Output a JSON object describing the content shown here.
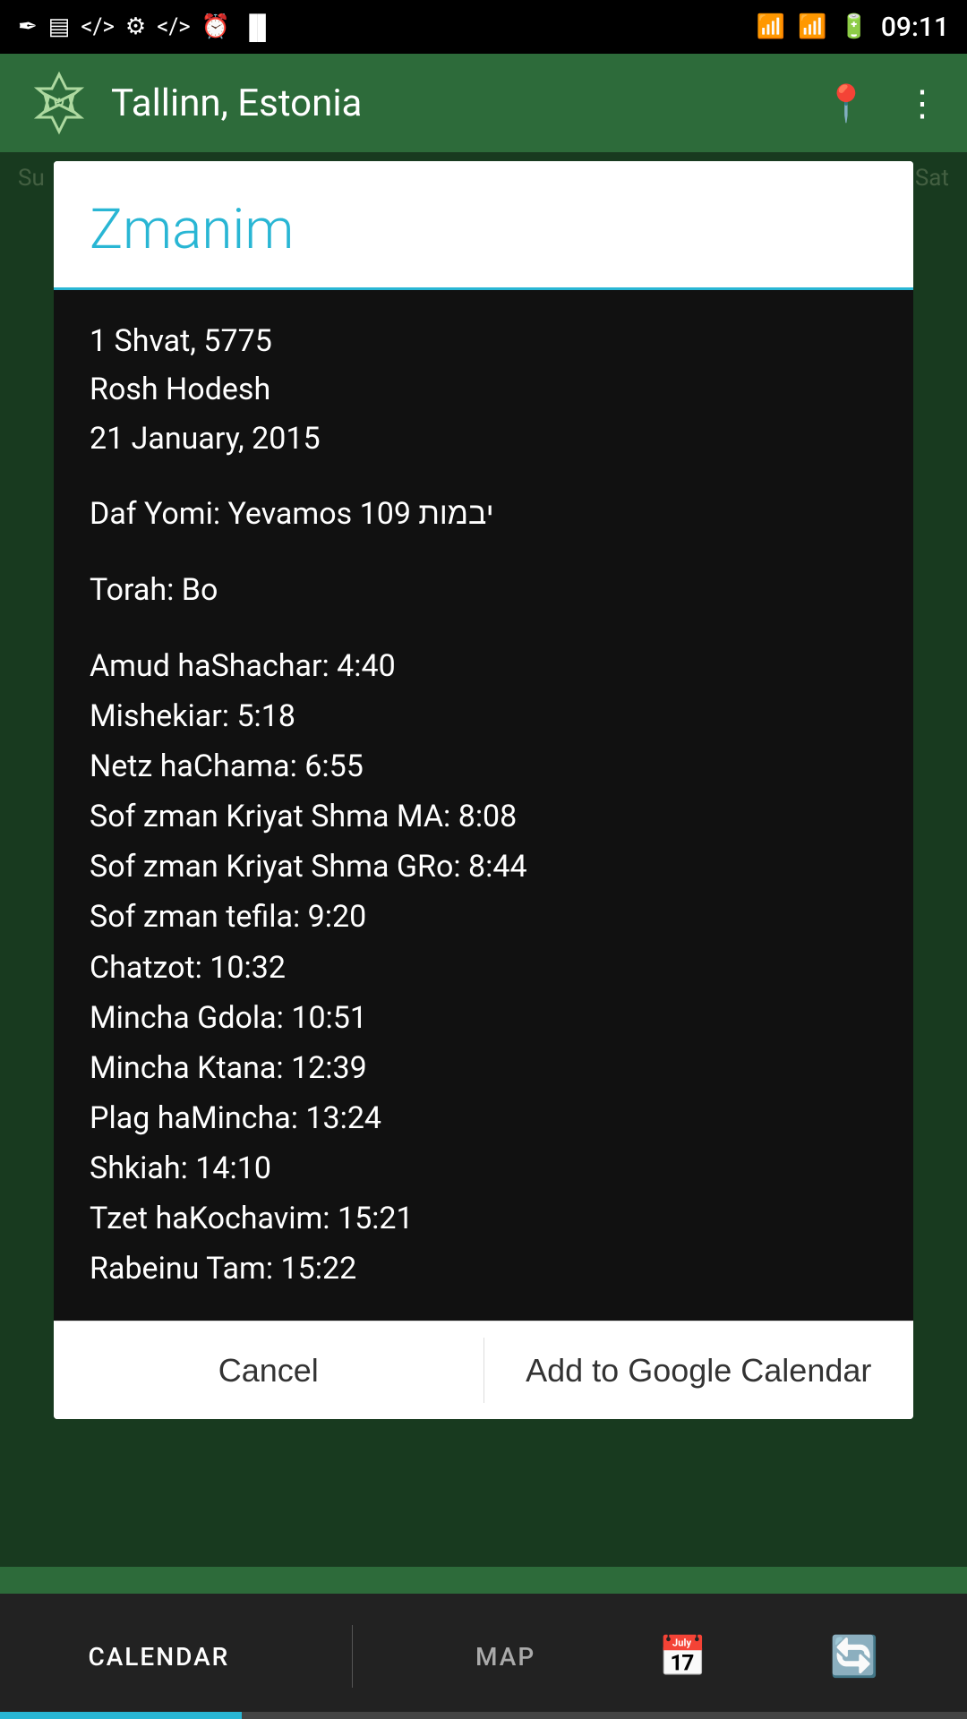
{
  "statusBar": {
    "time": "09:11",
    "leftIcons": [
      "feather-icon",
      "image-icon",
      "code-icon",
      "usb-icon",
      "code2-icon",
      "clock-icon",
      "barcode-icon"
    ],
    "rightIcons": [
      "wifi-icon",
      "signal-icon",
      "battery-icon"
    ]
  },
  "header": {
    "appTitle": "Tallinn, Estonia",
    "logoAlt": "Jewish calendar app logo"
  },
  "dialog": {
    "title": "Zmanim",
    "dateHebrew": "1 Shvat, 5775",
    "dateSpecial": "Rosh Hodesh",
    "dateGregorian": "21 January, 2015",
    "dafYomi": "Daf Yomi: Yevamos 109 יבמות",
    "torah": "Torah: Bo",
    "zmanim": [
      "Amud haShachar: 4:40",
      "Mishekiar: 5:18",
      "Netz haChama: 6:55",
      "Sof zman Kriyat Shma MA: 8:08",
      "Sof zman Kriyat Shma GRo: 8:44",
      "Sof zman tefila: 9:20",
      "Chatzot: 10:32",
      "Mincha Gdola: 10:51",
      "Mincha Ktana: 12:39",
      "Plag haMincha: 13:24",
      "Shkiah: 14:10",
      "Tzet haKochavim: 15:21",
      "Rabeinu Tam: 15:22"
    ],
    "cancelButton": "Cancel",
    "addCalendarButton": "Add to Google Calendar"
  },
  "bottomNav": {
    "calendarLabel": "CALENDAR",
    "mapLabel": "MAP",
    "calendarIcon": "📅",
    "refreshIcon": "🔄"
  },
  "colors": {
    "accent": "#29b6d4",
    "headerBg": "#2d6b3a",
    "dialogTitleColor": "#29b6d4",
    "bodyBg": "#111111"
  }
}
